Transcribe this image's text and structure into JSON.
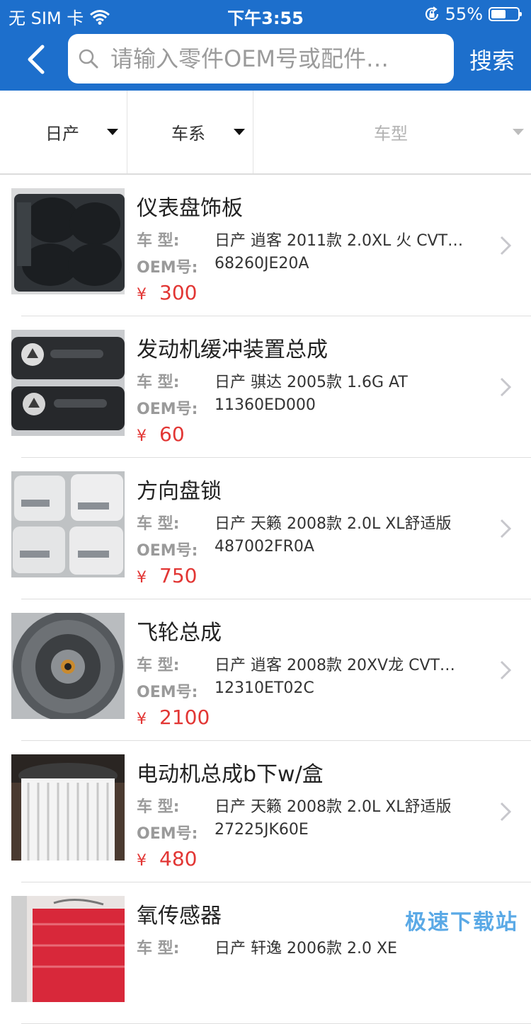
{
  "status_bar": {
    "carrier": "无 SIM 卡",
    "time": "下午3:55",
    "battery_percent": "55%",
    "battery_level": 0.55,
    "icons": [
      "wifi-icon",
      "lock-rotation-icon",
      "battery-icon"
    ]
  },
  "header": {
    "search_placeholder": "请输入零件OEM号或配件…",
    "search_label": "搜索",
    "accent_color": "#1d6fcc"
  },
  "filters": [
    {
      "label": "日产"
    },
    {
      "label": "车系"
    },
    {
      "label": "车型"
    }
  ],
  "list": {
    "model_label": "车    型:",
    "oem_label": "OEM号:",
    "currency": "¥",
    "price_color": "#e23634",
    "items": [
      {
        "title": "仪表盘饰板",
        "model": "日产 逍客 2011款 2.0XL 火 CVT…",
        "oem": "68260JE20A",
        "price": "300"
      },
      {
        "title": "发动机缓冲装置总成",
        "model": "日产 骐达 2005款 1.6G AT",
        "oem": "11360ED000",
        "price": "60"
      },
      {
        "title": "方向盘锁",
        "model": "日产 天籁 2008款 2.0L XL舒适版",
        "oem": "487002FR0A",
        "price": "750"
      },
      {
        "title": "飞轮总成",
        "model": "日产 逍客 2008款 20XV龙 CVT…",
        "oem": "12310ET02C",
        "price": "2100"
      },
      {
        "title": "电动机总成b下w/盒",
        "model": "日产 天籁 2008款 2.0L XL舒适版",
        "oem": "27225JK60E",
        "price": "480"
      },
      {
        "title": "氧传感器",
        "model": "日产 轩逸 2006款 2.0 XE",
        "oem": "",
        "price": ""
      }
    ]
  },
  "watermark": "极速下载站"
}
